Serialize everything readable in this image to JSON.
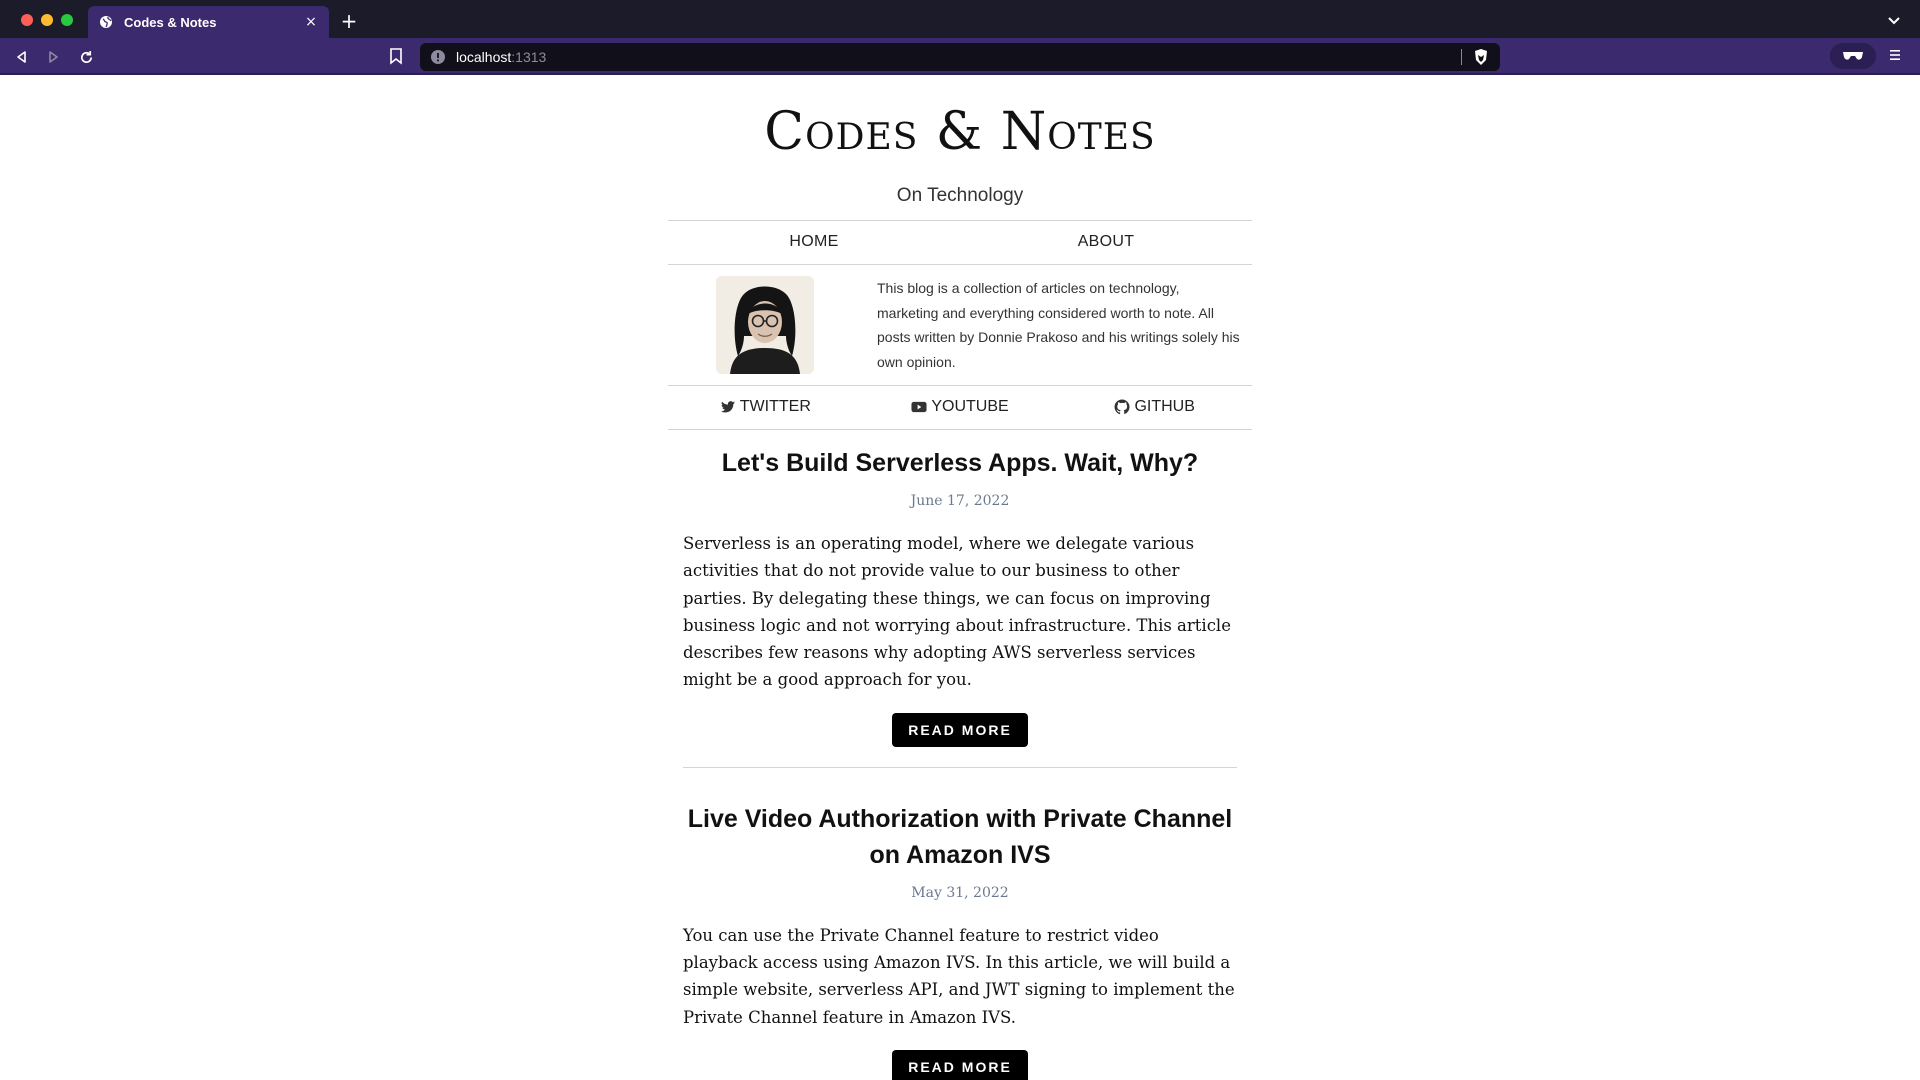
{
  "browser": {
    "tab_title": "Codes & Notes",
    "new_tab": "+",
    "tab_close": "×",
    "url_host": "localhost",
    "url_port": ":1313"
  },
  "site": {
    "title": "Codes & Notes",
    "subtitle": "On Technology",
    "nav": [
      "HOME",
      "ABOUT"
    ],
    "bio": "This blog is a collection of articles on technology, marketing and everything considered worth to note. All posts written by Donnie Prakoso and his writings solely his own opinion.",
    "social": [
      {
        "label": "TWITTER",
        "icon": "twitter-icon"
      },
      {
        "label": "YOUTUBE",
        "icon": "youtube-icon"
      },
      {
        "label": "GITHUB",
        "icon": "github-icon"
      }
    ]
  },
  "posts": [
    {
      "title": "Let's Build Serverless Apps. Wait, Why?",
      "date": "June 17, 2022",
      "excerpt": "Serverless is an operating model, where we delegate various activities that do not provide value to our business to other parties. By delegating these things, we can focus on improving business logic and not worrying about infrastructure. This article describes few reasons why adopting AWS serverless services might be a good approach for you.",
      "button": "READ MORE"
    },
    {
      "title": "Live Video Authorization with Private Channel on Amazon IVS",
      "date": "May 31, 2022",
      "excerpt": "You can use the Private Channel feature to restrict video playback access using Amazon IVS. In this article, we will build a simple website, serverless API, and JWT signing to implement the Private Channel feature in Amazon IVS.",
      "button": "READ MORE"
    }
  ]
}
